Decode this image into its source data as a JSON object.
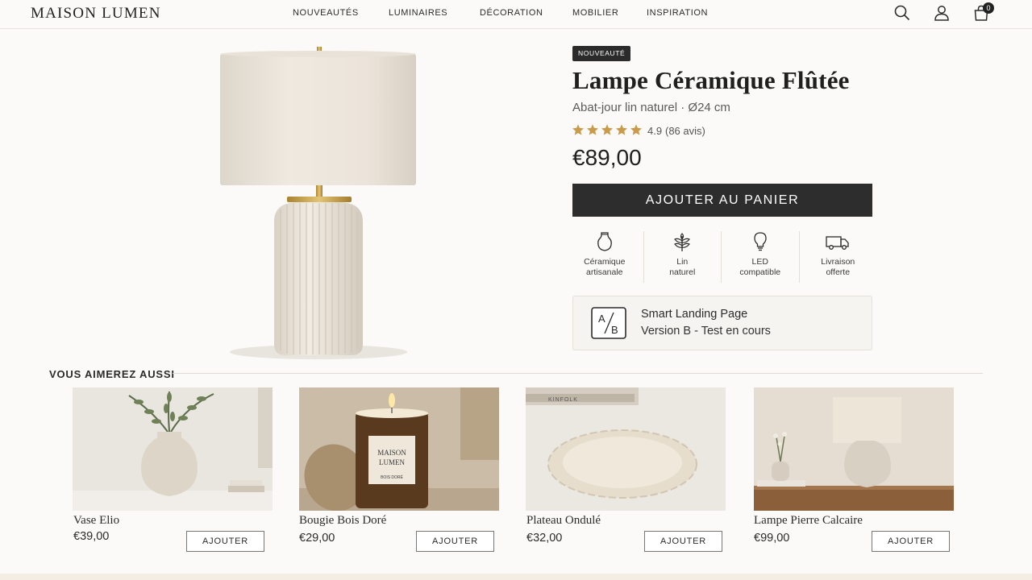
{
  "brand": "MAISON LUMEN",
  "nav": [
    "NOUVEAUTÉS",
    "LUMINAIRES",
    "DÉCORATION",
    "MOBILIER",
    "INSPIRATION"
  ],
  "cart_count": "0",
  "icons": [
    "search-icon",
    "user-icon",
    "shopping-bag-icon"
  ],
  "product": {
    "badge": "NOUVEAUTÉ",
    "title": "Lampe Céramique Flûtée",
    "subtitle": "Abat-jour lin naturel · Ø24 cm",
    "rating_value": "4.9",
    "stars": 5,
    "reviews": "(86 avis)",
    "price": "€89,00",
    "add_to_cart": "AJOUTER AU PANIER",
    "features": [
      {
        "icon": "vase-icon",
        "line1": "Céramique",
        "line2": "artisanale"
      },
      {
        "icon": "leaf-icon",
        "line1": "Lin",
        "line2": "naturel"
      },
      {
        "icon": "bulb-icon",
        "line1": "LED",
        "line2": "compatible"
      },
      {
        "icon": "truck-icon",
        "line1": "Livraison",
        "line2": "offerte"
      }
    ],
    "ab_test": {
      "icon_text_a": "A",
      "icon_text_b": "B",
      "title": "Smart Landing Page",
      "subtitle": "Version B - Test en cours"
    }
  },
  "recommendations": {
    "heading": "VOUS AIMEREZ AUSSI",
    "items": [
      {
        "name": "Vase Elio",
        "price": "€39,00",
        "button": "AJOUTER"
      },
      {
        "name": "Bougie Bois Doré",
        "price": "€29,00",
        "button": "AJOUTER",
        "label_line1": "MAISON",
        "label_line2": "LUMEN",
        "label_line3": "BOIS DORÉ"
      },
      {
        "name": "Plateau Ondulé",
        "price": "€32,00",
        "button": "AJOUTER",
        "book_text": "KINFOLK"
      },
      {
        "name": "Lampe Pierre Calcaire",
        "price": "€99,00",
        "button": "AJOUTER"
      }
    ]
  },
  "colors": {
    "accent_dark": "#2d2d2d",
    "star": "#c99a4a",
    "brass": "#c9a24e",
    "background": "#fbfaf8"
  }
}
